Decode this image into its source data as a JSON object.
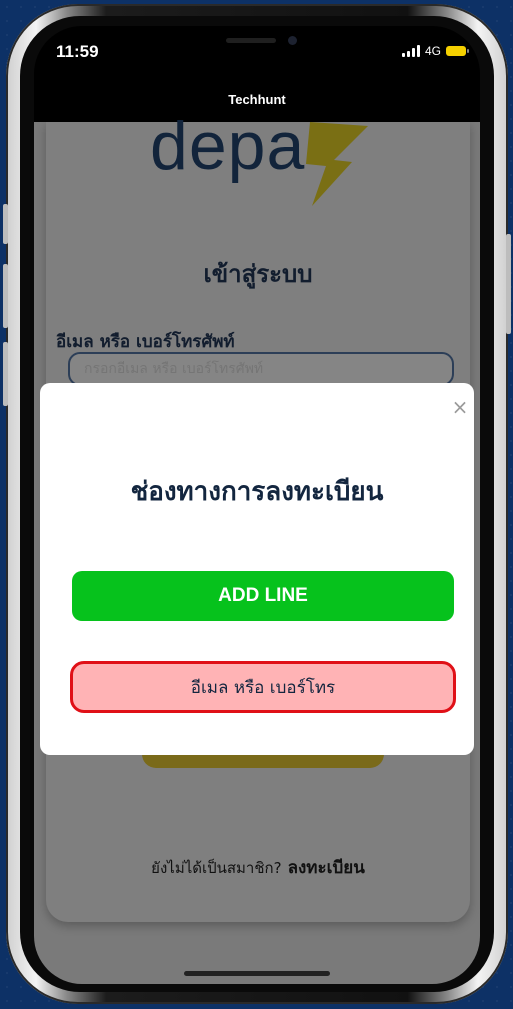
{
  "status_bar": {
    "time": "11:59",
    "network": "4G"
  },
  "app": {
    "title": "Techhunt"
  },
  "login": {
    "logo_text": "depa",
    "title": "เข้าสู่ระบบ",
    "field_label": "อีเมล หรือ เบอร์โทรศัพท์",
    "field_placeholder": "กรอกอีเมล หรือ เบอร์โทรศัพท์",
    "register_prompt": "ยังไม่ได้เป็นสมาชิก?",
    "register_link": "ลงทะเบียน"
  },
  "modal": {
    "close_symbol": "×",
    "title": "ช่องทางการลงทะเบียน",
    "line_button": "ADD LINE",
    "email_button": "อีเมล หรือ เบอร์โทร"
  },
  "colors": {
    "page_background": "#0d3166",
    "line_green": "#06c21c",
    "highlight_red": "#e01017",
    "highlight_fill": "#ffb3b5",
    "logo_navy": "#12243b",
    "logo_yellow": "#e6d400"
  }
}
